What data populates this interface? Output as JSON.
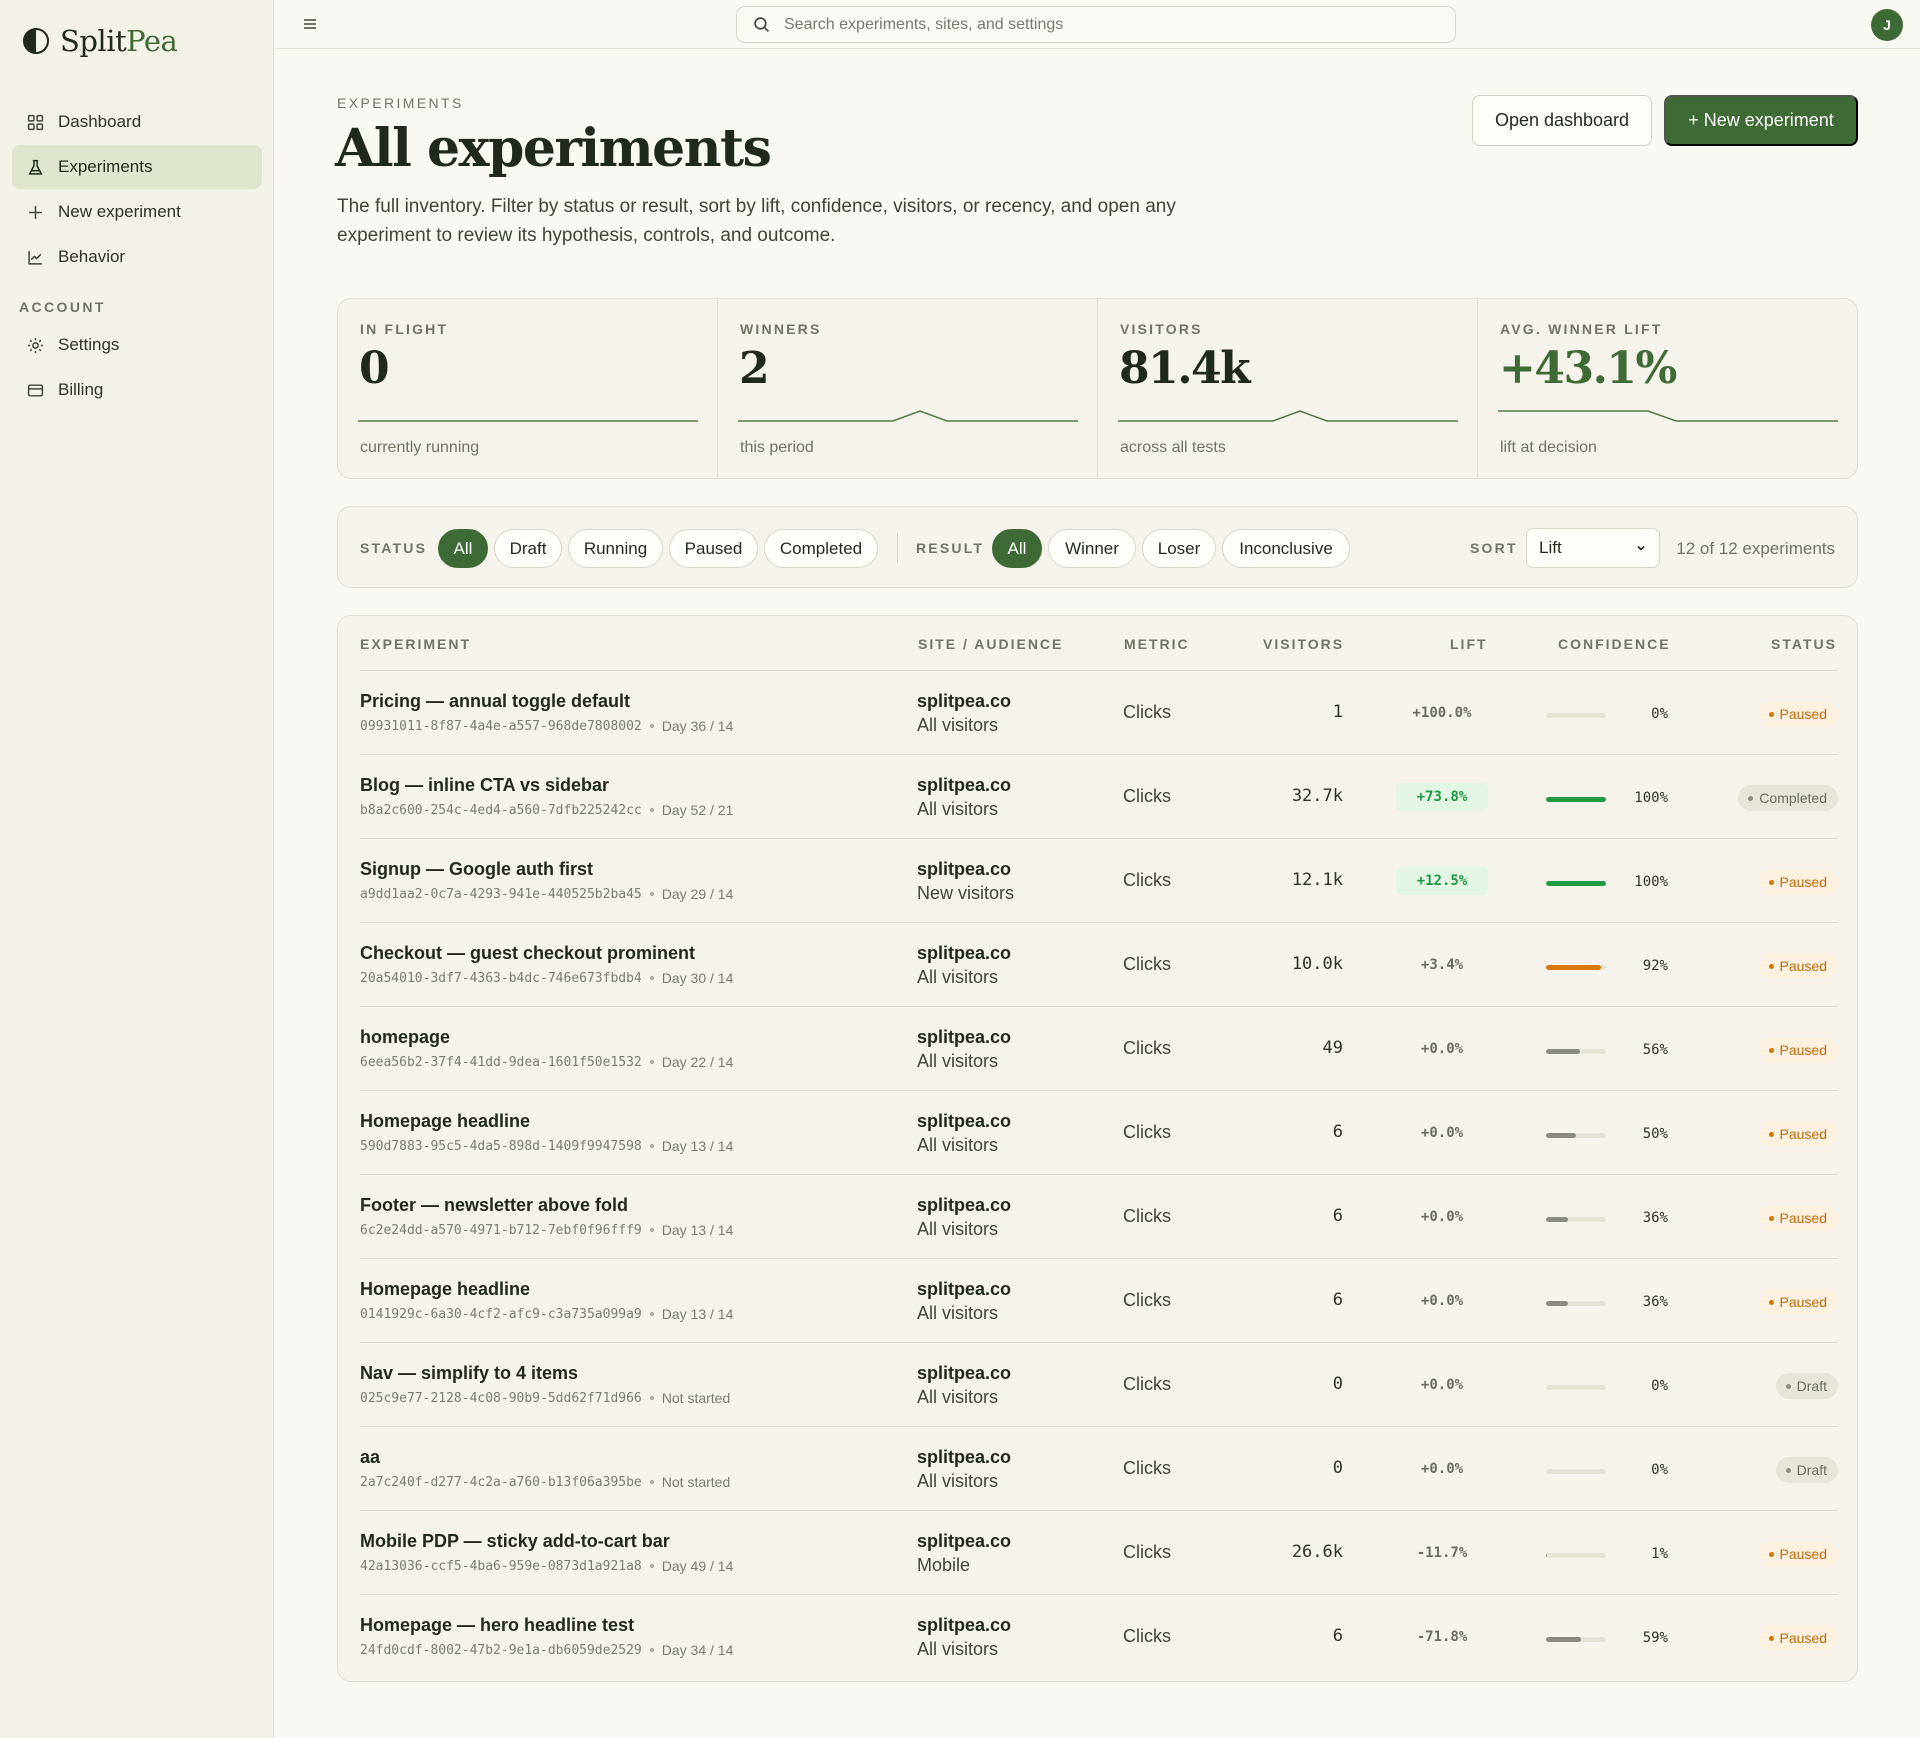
{
  "app": {
    "brand_left": "Split",
    "brand_right": "Pea"
  },
  "sidebar": {
    "items": [
      {
        "label": "Dashboard",
        "icon": "grid-icon"
      },
      {
        "label": "Experiments",
        "icon": "flask-icon",
        "active": true
      },
      {
        "label": "New experiment",
        "icon": "plus-icon"
      },
      {
        "label": "Behavior",
        "icon": "behavior-icon"
      }
    ],
    "account_label": "ACCOUNT",
    "account_items": [
      {
        "label": "Settings",
        "icon": "gear-icon"
      },
      {
        "label": "Billing",
        "icon": "card-icon"
      }
    ]
  },
  "topbar": {
    "search_placeholder": "Search experiments, sites, and settings",
    "avatar_initial": "J"
  },
  "header": {
    "eyebrow": "EXPERIMENTS",
    "title": "All experiments",
    "description": "The full inventory. Filter by status or result, sort by lift, confidence, visitors, or recency, and open any experiment to review its hypothesis, controls, and outcome.",
    "open_dashboard": "Open dashboard",
    "new_experiment": "+ New experiment"
  },
  "stats": [
    {
      "label": "IN FLIGHT",
      "value": "0",
      "sub": "currently running",
      "spark": "flat"
    },
    {
      "label": "WINNERS",
      "value": "2",
      "sub": "this period",
      "spark": "bump-right"
    },
    {
      "label": "VISITORS",
      "value": "81.4k",
      "sub": "across all tests",
      "spark": "bump-right"
    },
    {
      "label": "AVG. WINNER LIFT",
      "value": "+43.1%",
      "sub": "lift at decision",
      "spark": "bump-center"
    }
  ],
  "filters": {
    "status_label": "STATUS",
    "status_options": [
      "All",
      "Draft",
      "Running",
      "Paused",
      "Completed"
    ],
    "status_selected": "All",
    "result_label": "RESULT",
    "result_options": [
      "All",
      "Winner",
      "Loser",
      "Inconclusive"
    ],
    "result_selected": "All",
    "sort_label": "SORT",
    "sort_value": "Lift",
    "count_text": "12 of 12 experiments"
  },
  "table": {
    "headers": {
      "experiment": "EXPERIMENT",
      "site": "SITE / AUDIENCE",
      "metric": "METRIC",
      "visitors": "VISITORS",
      "lift": "LIFT",
      "confidence": "CONFIDENCE",
      "status": "STATUS"
    },
    "rows": [
      {
        "name": "Pricing — annual toggle default",
        "id": "09931011-8f87-4a4e-a557-968de7808002",
        "day": "Day 36 / 14",
        "site": "splitpea.co",
        "audience": "All visitors",
        "metric": "Clicks",
        "visitors": "1",
        "lift": "+100.0%",
        "lift_kind": "neutral",
        "confidence": "0%",
        "conf_value": 0,
        "conf_color": "#8a8b80",
        "status": "Paused",
        "status_kind": "paused"
      },
      {
        "name": "Blog — inline CTA vs sidebar",
        "id": "b8a2c600-254c-4ed4-a560-7dfb225242cc",
        "day": "Day 52 / 21",
        "site": "splitpea.co",
        "audience": "All visitors",
        "metric": "Clicks",
        "visitors": "32.7k",
        "lift": "+73.8%",
        "lift_kind": "pos",
        "confidence": "100%",
        "conf_value": 100,
        "conf_color": "#1f9a3f",
        "status": "Completed",
        "status_kind": "completed"
      },
      {
        "name": "Signup — Google auth first",
        "id": "a9dd1aa2-0c7a-4293-941e-440525b2ba45",
        "day": "Day 29 / 14",
        "site": "splitpea.co",
        "audience": "New visitors",
        "metric": "Clicks",
        "visitors": "12.1k",
        "lift": "+12.5%",
        "lift_kind": "pos",
        "confidence": "100%",
        "conf_value": 100,
        "conf_color": "#1f9a3f",
        "status": "Paused",
        "status_kind": "paused"
      },
      {
        "name": "Checkout — guest checkout prominent",
        "id": "20a54010-3df7-4363-b4dc-746e673fbdb4",
        "day": "Day 30 / 14",
        "site": "splitpea.co",
        "audience": "All visitors",
        "metric": "Clicks",
        "visitors": "10.0k",
        "lift": "+3.4%",
        "lift_kind": "neutral",
        "confidence": "92%",
        "conf_value": 92,
        "conf_color": "#d97706",
        "status": "Paused",
        "status_kind": "paused"
      },
      {
        "name": "homepage",
        "id": "6eea56b2-37f4-41dd-9dea-1601f50e1532",
        "day": "Day 22 / 14",
        "site": "splitpea.co",
        "audience": "All visitors",
        "metric": "Clicks",
        "visitors": "49",
        "lift": "+0.0%",
        "lift_kind": "neutral",
        "confidence": "56%",
        "conf_value": 56,
        "conf_color": "#8a8b80",
        "status": "Paused",
        "status_kind": "paused"
      },
      {
        "name": "Homepage headline",
        "id": "590d7883-95c5-4da5-898d-1409f9947598",
        "day": "Day 13 / 14",
        "site": "splitpea.co",
        "audience": "All visitors",
        "metric": "Clicks",
        "visitors": "6",
        "lift": "+0.0%",
        "lift_kind": "neutral",
        "confidence": "50%",
        "conf_value": 50,
        "conf_color": "#8a8b80",
        "status": "Paused",
        "status_kind": "paused"
      },
      {
        "name": "Footer — newsletter above fold",
        "id": "6c2e24dd-a570-4971-b712-7ebf0f96fff9",
        "day": "Day 13 / 14",
        "site": "splitpea.co",
        "audience": "All visitors",
        "metric": "Clicks",
        "visitors": "6",
        "lift": "+0.0%",
        "lift_kind": "neutral",
        "confidence": "36%",
        "conf_value": 36,
        "conf_color": "#8a8b80",
        "status": "Paused",
        "status_kind": "paused"
      },
      {
        "name": "Homepage headline",
        "id": "0141929c-6a30-4cf2-afc9-c3a735a099a9",
        "day": "Day 13 / 14",
        "site": "splitpea.co",
        "audience": "All visitors",
        "metric": "Clicks",
        "visitors": "6",
        "lift": "+0.0%",
        "lift_kind": "neutral",
        "confidence": "36%",
        "conf_value": 36,
        "conf_color": "#8a8b80",
        "status": "Paused",
        "status_kind": "paused"
      },
      {
        "name": "Nav — simplify to 4 items",
        "id": "025c9e77-2128-4c08-90b9-5dd62f71d966",
        "day": "Not started",
        "site": "splitpea.co",
        "audience": "All visitors",
        "metric": "Clicks",
        "visitors": "0",
        "lift": "+0.0%",
        "lift_kind": "neutral",
        "confidence": "0%",
        "conf_value": 0,
        "conf_color": "#8a8b80",
        "status": "Draft",
        "status_kind": "draft"
      },
      {
        "name": "aa",
        "id": "2a7c240f-d277-4c2a-a760-b13f06a395be",
        "day": "Not started",
        "site": "splitpea.co",
        "audience": "All visitors",
        "metric": "Clicks",
        "visitors": "0",
        "lift": "+0.0%",
        "lift_kind": "neutral",
        "confidence": "0%",
        "conf_value": 0,
        "conf_color": "#8a8b80",
        "status": "Draft",
        "status_kind": "draft"
      },
      {
        "name": "Mobile PDP — sticky add-to-cart bar",
        "id": "42a13036-ccf5-4ba6-959e-0873d1a921a8",
        "day": "Day 49 / 14",
        "site": "splitpea.co",
        "audience": "Mobile",
        "metric": "Clicks",
        "visitors": "26.6k",
        "lift": "-11.7%",
        "lift_kind": "neg",
        "confidence": "1%",
        "conf_value": 1,
        "conf_color": "#8a8b80",
        "status": "Paused",
        "status_kind": "paused"
      },
      {
        "name": "Homepage — hero headline test",
        "id": "24fd0cdf-8002-47b2-9e1a-db6059de2529",
        "day": "Day 34 / 14",
        "site": "splitpea.co",
        "audience": "All visitors",
        "metric": "Clicks",
        "visitors": "6",
        "lift": "-71.8%",
        "lift_kind": "neg",
        "confidence": "59%",
        "conf_value": 59,
        "conf_color": "#8a8b80",
        "status": "Paused",
        "status_kind": "paused"
      }
    ]
  }
}
